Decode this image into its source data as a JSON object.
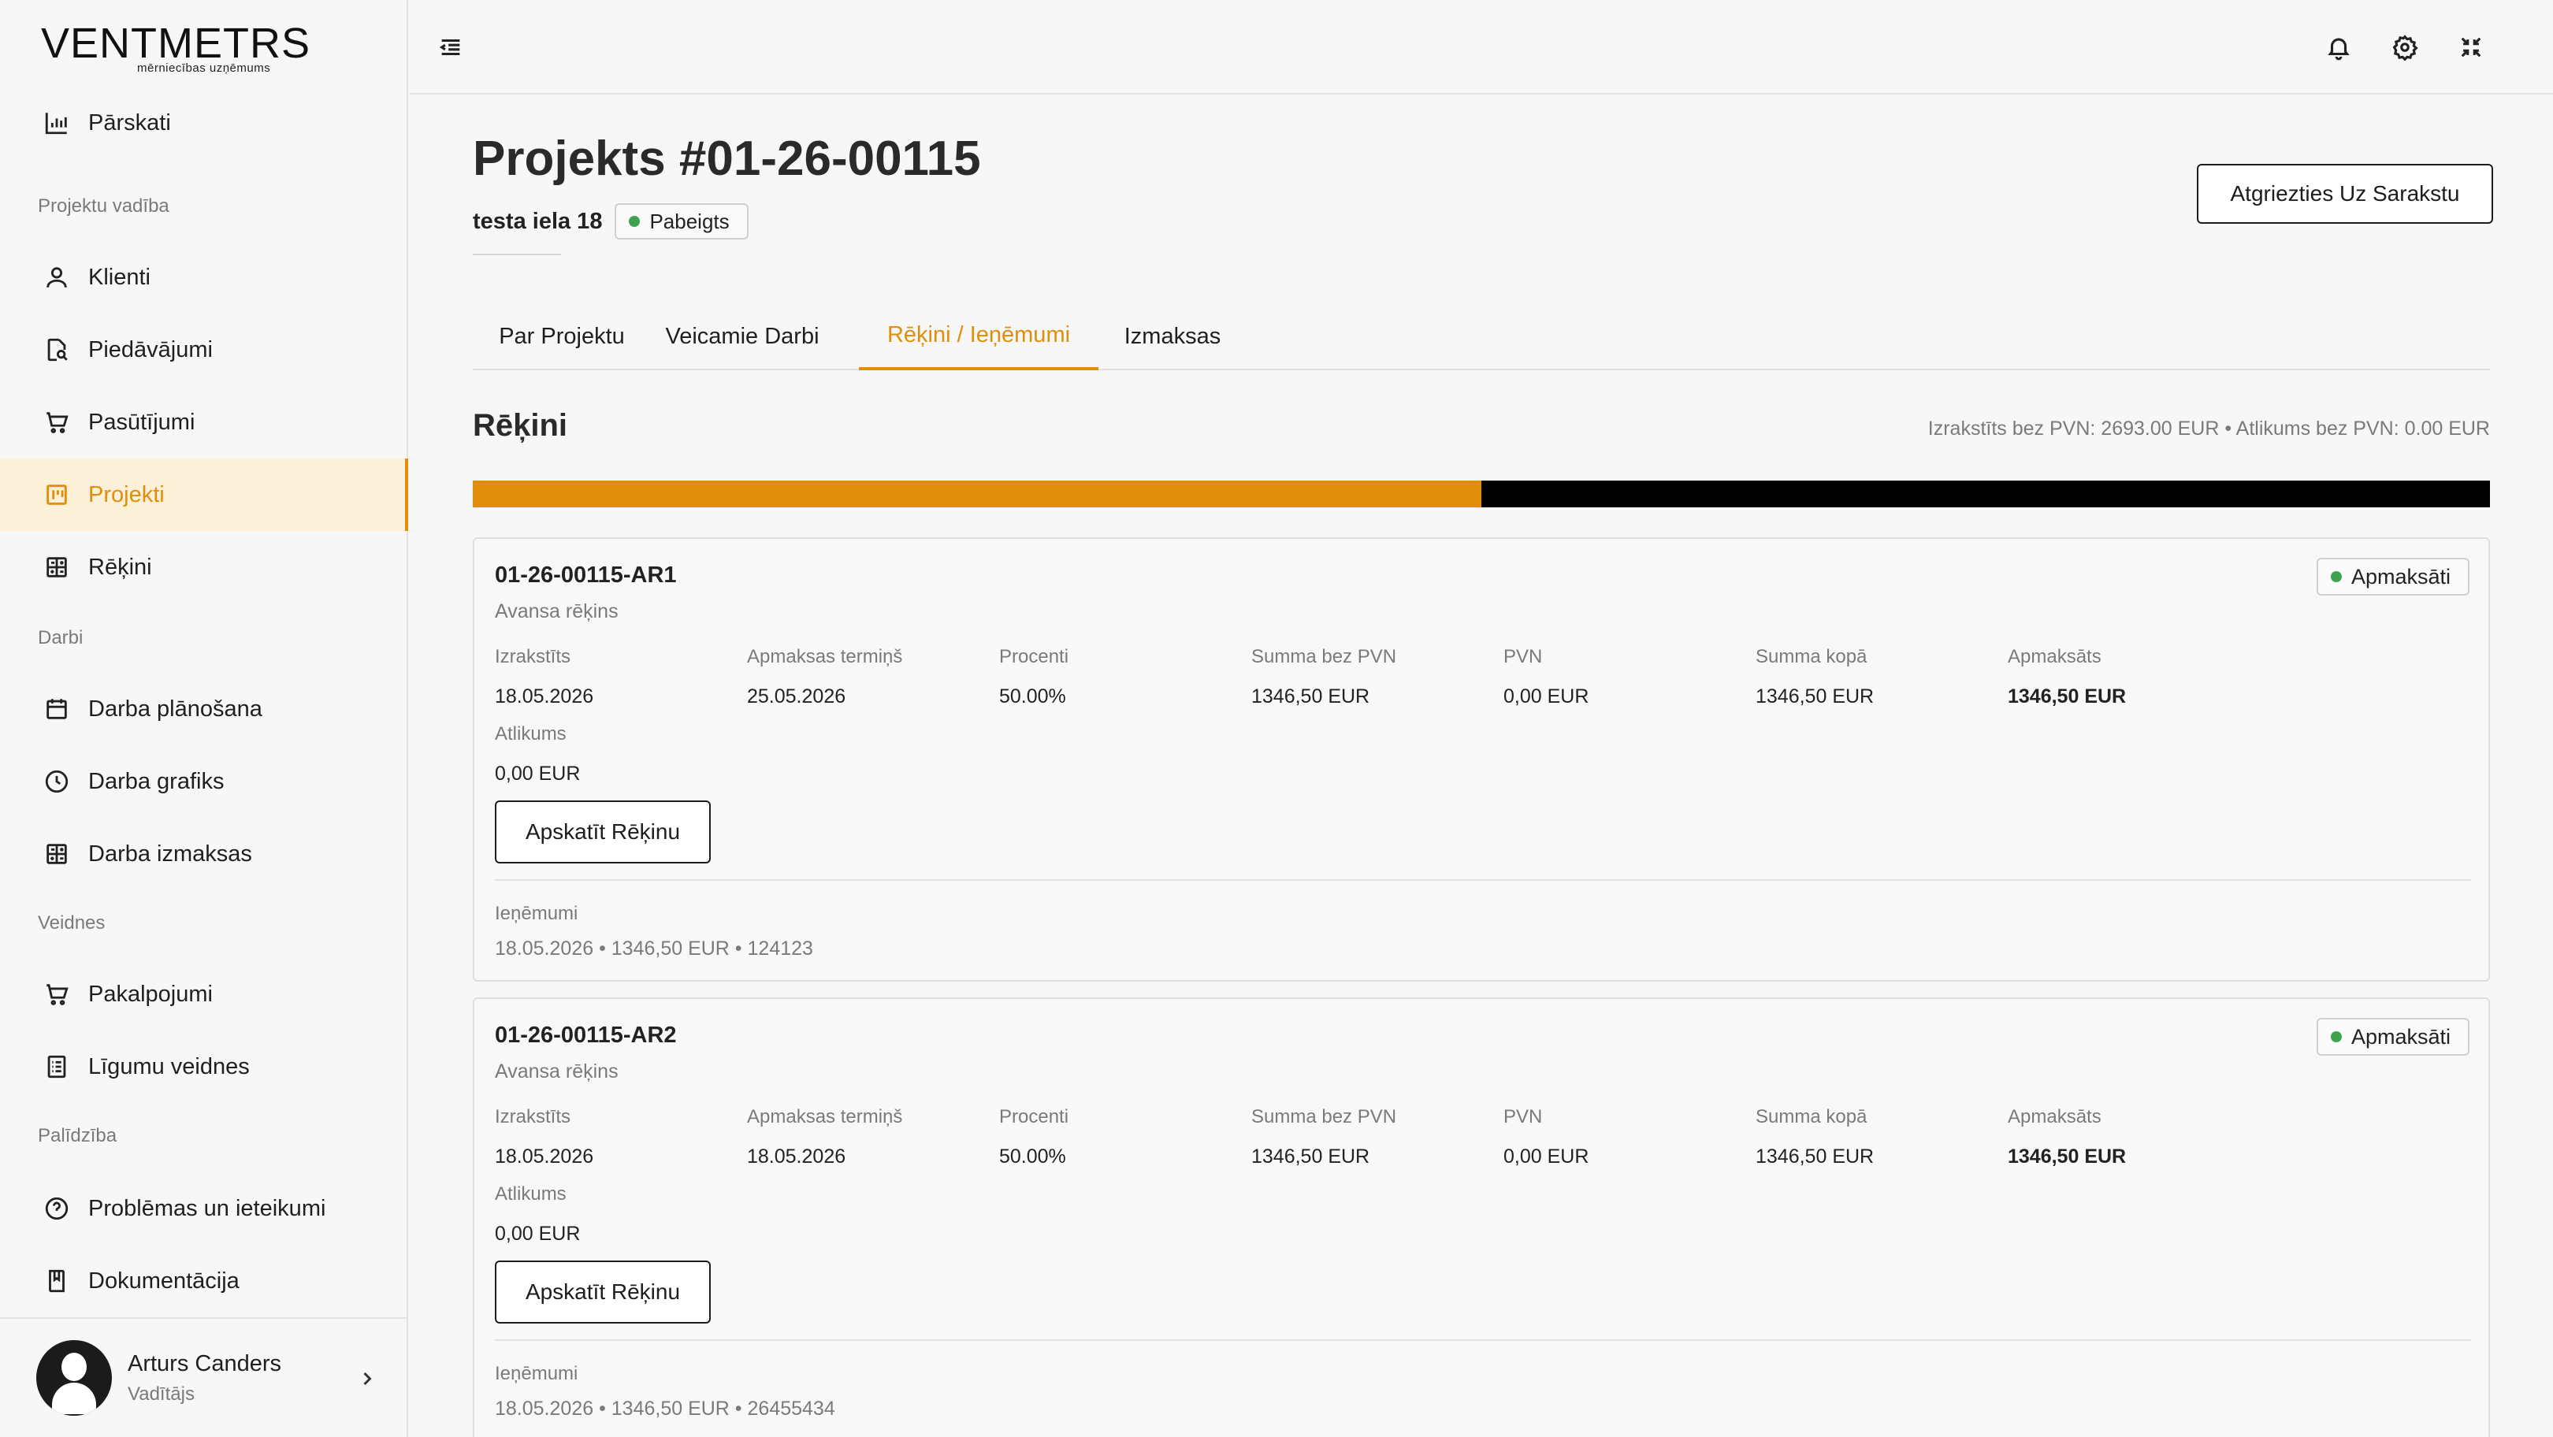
{
  "sidebar": {
    "logo": {
      "word": "VENTMETRS",
      "sub": "mērniecības uzņēmums"
    },
    "items": [
      {
        "label": "Pārskati",
        "icon": "bar-chart-icon"
      },
      {
        "label": "Klienti",
        "icon": "user-icon"
      },
      {
        "label": "Piedāvājumi",
        "icon": "document-search-icon"
      },
      {
        "label": "Pasūtījumi",
        "icon": "shopping-cart-icon"
      },
      {
        "label": "Projekti",
        "icon": "kanban-board-icon",
        "active": true
      },
      {
        "label": "Rēķini",
        "icon": "calculator-icon"
      },
      {
        "label": "Darba plānošana",
        "icon": "calendar-icon"
      },
      {
        "label": "Darba grafiks",
        "icon": "clock-icon"
      },
      {
        "label": "Darba izmaksas",
        "icon": "calculator-icon"
      },
      {
        "label": "Pakalpojumi",
        "icon": "shopping-cart-icon"
      },
      {
        "label": "Līgumu veidnes",
        "icon": "list-document-icon"
      },
      {
        "label": "Problēmas un ieteikumi",
        "icon": "help-circle-icon"
      },
      {
        "label": "Dokumentācija",
        "icon": "book-icon"
      }
    ],
    "sections": {
      "projects": "Projektu vadība",
      "work": "Darbi",
      "templates": "Veidnes",
      "help": "Palīdzība"
    },
    "user": {
      "name": "Arturs Canders",
      "role": "Vadītājs"
    }
  },
  "topbar": {
    "icons": [
      "menu-collapse-icon",
      "bell-icon",
      "gear-icon",
      "fullscreen-exit-icon"
    ]
  },
  "project": {
    "title": "Projekts #01-26-00115",
    "address": "testa iela 18",
    "status": "Pabeigts",
    "back_label": "Atgriezties Uz Sarakstu"
  },
  "tabs": [
    {
      "label": "Par Projektu"
    },
    {
      "label": "Veicamie Darbi"
    },
    {
      "label": "Rēķini / Ieņēmumi",
      "active": true
    },
    {
      "label": "Izmaksas"
    }
  ],
  "invoices_section": {
    "title": "Rēķini",
    "summary": "Izrakstīts bez PVN: 2693.00 EUR • Atlikums bez PVN: 0.00 EUR",
    "progress_fraction": 0.5,
    "accent_color": "#e08e0b",
    "status_color": "#3fa34d"
  },
  "field_labels": {
    "issued": "Izrakstīts",
    "due": "Apmaksas termiņš",
    "percent": "Procenti",
    "sum_net": "Summa bez PVN",
    "vat": "PVN",
    "sum_total": "Summa kopā",
    "paid": "Apmaksāts",
    "balance": "Atlikums"
  },
  "invoices": [
    {
      "number": "01-26-00115-AR1",
      "type": "Avansa rēķins",
      "status": "Apmaksāti",
      "issued": "18.05.2026",
      "due": "25.05.2026",
      "percent": "50.00%",
      "sum_net": "1346,50 EUR",
      "vat": "0,00 EUR",
      "sum_total": "1346,50 EUR",
      "paid": "1346,50 EUR",
      "balance": "0,00 EUR",
      "view_label": "Apskatīt Rēķinu",
      "income_label": "Ieņēmumi",
      "income_line": "18.05.2026 • 1346,50 EUR • 124123"
    },
    {
      "number": "01-26-00115-AR2",
      "type": "Avansa rēķins",
      "status": "Apmaksāti",
      "issued": "18.05.2026",
      "due": "18.05.2026",
      "percent": "50.00%",
      "sum_net": "1346,50 EUR",
      "vat": "0,00 EUR",
      "sum_total": "1346,50 EUR",
      "paid": "1346,50 EUR",
      "balance": "0,00 EUR",
      "view_label": "Apskatīt Rēķinu",
      "income_label": "Ieņēmumi",
      "income_line": "18.05.2026 • 1346,50 EUR • 26455434"
    }
  ]
}
